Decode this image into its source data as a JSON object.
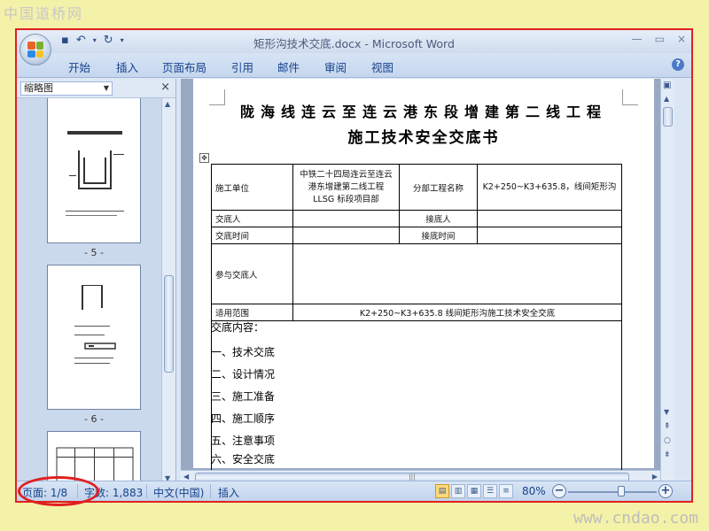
{
  "watermarks": {
    "top": "中国道桥网",
    "bottom": "www.cndao.com"
  },
  "window": {
    "title": "矩形沟技术交底.docx - Microsoft Word",
    "minimize": "—",
    "restore": "▭",
    "close": "×"
  },
  "menu": {
    "tabs": [
      "开始",
      "插入",
      "页面布局",
      "引用",
      "邮件",
      "审阅",
      "视图"
    ]
  },
  "thumbnails": {
    "selector": "缩略图",
    "pages": [
      "- 5 -",
      "- 6 -"
    ]
  },
  "document": {
    "title_line1": "陇海线连云至连云港东段增建第二线工程",
    "title_line2": "施工技术安全交底书",
    "table": {
      "row1": {
        "label1": "施工单位",
        "value1": "中铁二十四局连云至连云港东增建第二线工程 LLSG 标段项目部",
        "label2": "分部工程名称",
        "value2": "K2+250~K3+635.8，线间矩形沟"
      },
      "row2": {
        "label1": "交底人",
        "label2": "接底人"
      },
      "row3": {
        "label1": "交底时间",
        "label2": "接底时间"
      },
      "row4": {
        "label": "参与交底人"
      },
      "row5": {
        "label": "适用范围",
        "value": "K2+250~K3+635.8    线间矩形沟施工技术安全交底"
      }
    },
    "content_heading": "交底内容：",
    "sections": [
      "一、技术交底",
      "二、设计情况",
      "三、施工准备",
      "四、施工顺序",
      "五、注意事项",
      "六、安全交底"
    ]
  },
  "status": {
    "page": "页面: 1/8",
    "words": "字数: 1,883",
    "language": "中文(中国)",
    "mode": "插入",
    "zoom": "80%",
    "zoom_fraction": 0.6
  },
  "colors": {
    "accent": "#15428b",
    "highlight": "#e02020"
  }
}
